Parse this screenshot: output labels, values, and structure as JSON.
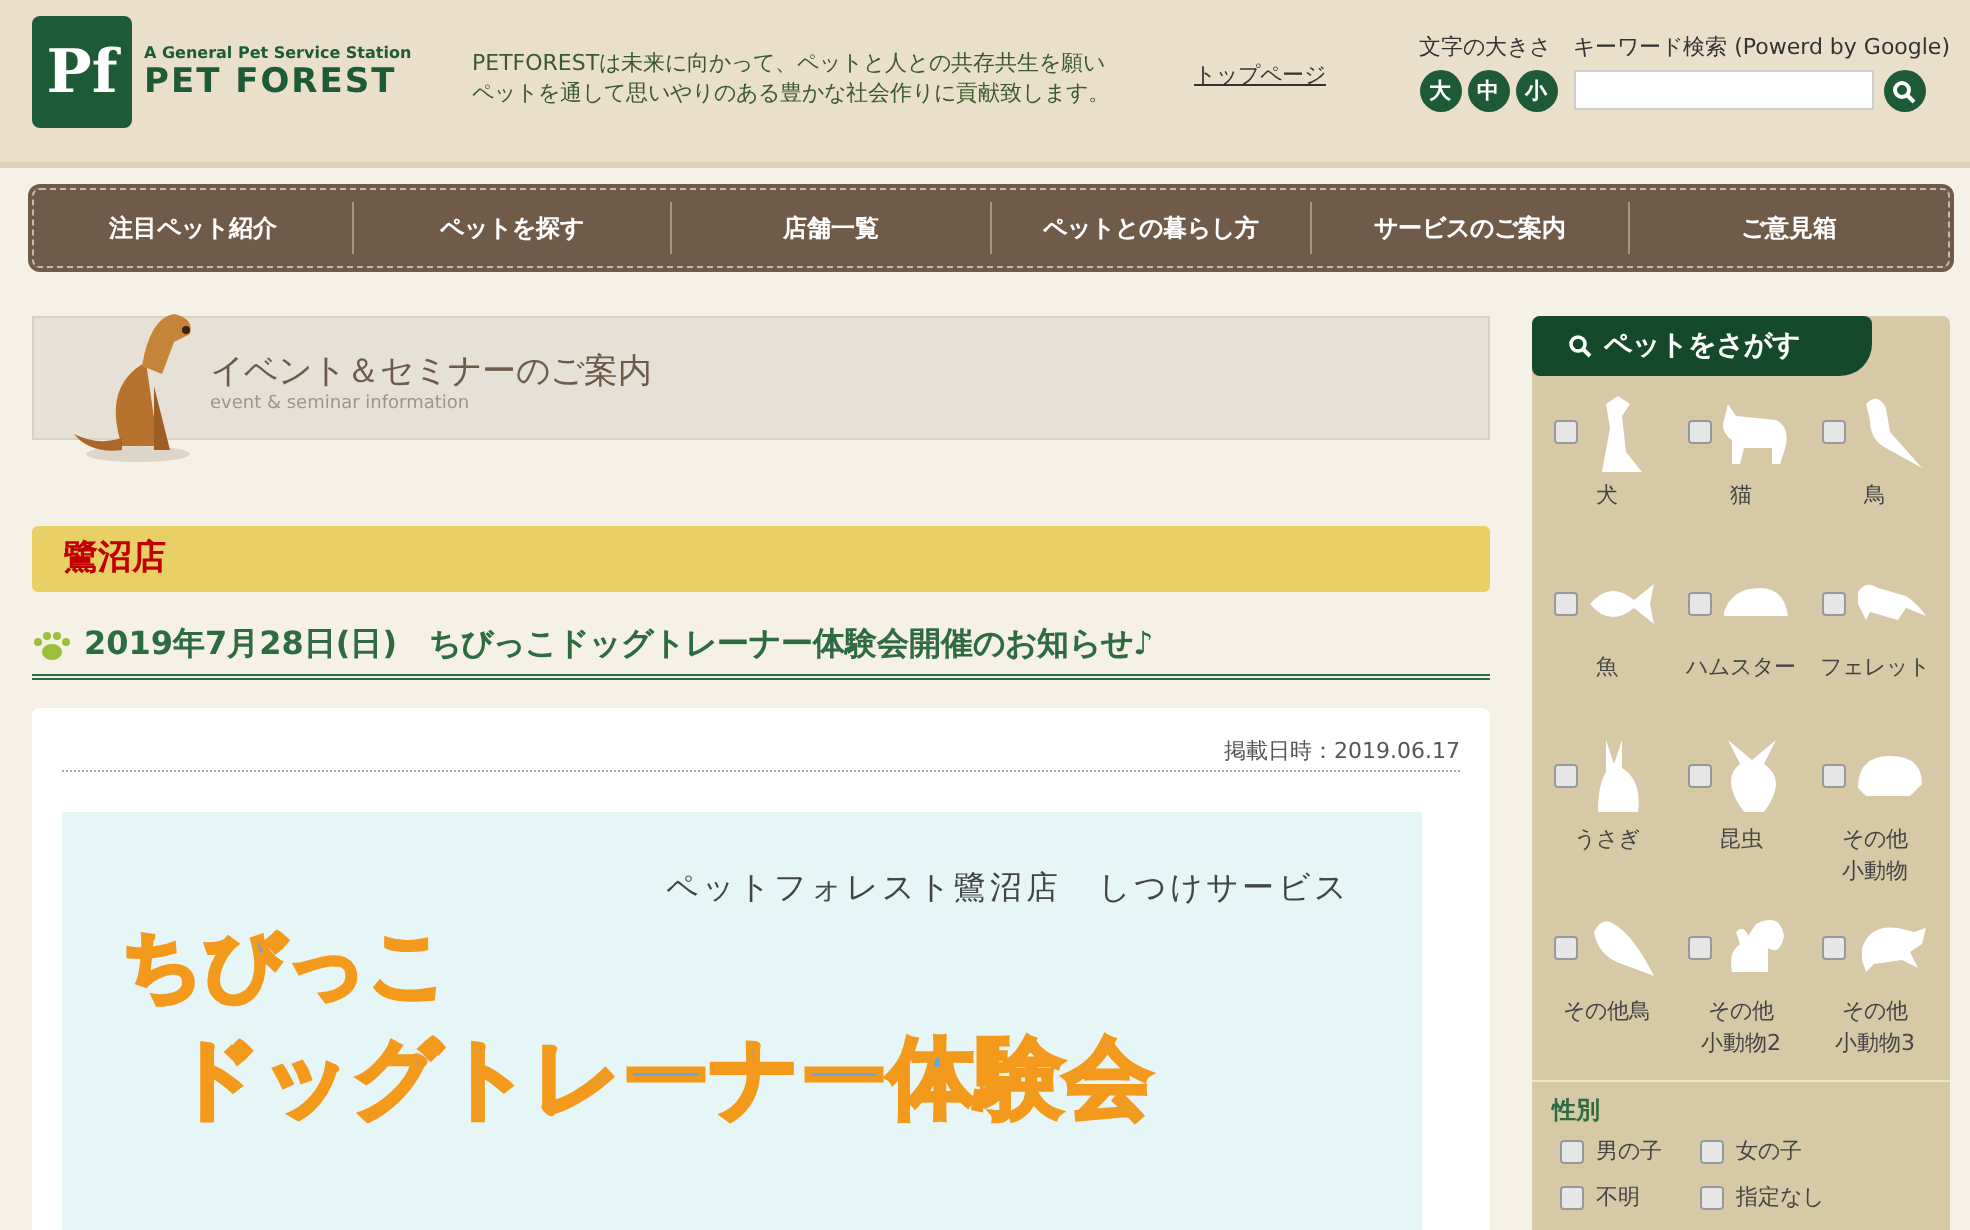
{
  "header": {
    "logo": {
      "mark": "Pf",
      "tagline": "A General Pet Service Station",
      "name": "PET FOREST"
    },
    "description": [
      "PETFORESTは未来に向かって、ペットと人との共存共生を願い",
      "ペットを通して思いやりのある豊かな社会作りに貢献致します。"
    ],
    "top_link": "トップページ",
    "font_size": {
      "label": "文字の大きさ",
      "buttons": [
        "大",
        "中",
        "小"
      ]
    },
    "search": {
      "label": "キーワード検索 (Powerd by Google)"
    }
  },
  "nav": [
    "注目ペット紹介",
    "ペットを探す",
    "店舗一覧",
    "ペットとの暮らし方",
    "サービスのご案内",
    "ご意見箱"
  ],
  "banner": {
    "title": "イベント＆セミナーのご案内",
    "subtitle": "event & seminar information"
  },
  "store": "鷺沼店",
  "article": {
    "title": "2019年7月28日(日)　ちびっこドッグトレーナー体験会開催のお知らせ♪",
    "posted": "掲載日時：2019.06.17",
    "flyer": {
      "subtitle": "ペットフォレスト鷺沼店　しつけサービス",
      "line1": "ちびっこ",
      "line2": "ドッグトレーナー体験会"
    }
  },
  "sidebar": {
    "heading": "ペットをさがす",
    "pets": [
      {
        "label": "犬",
        "checked": false
      },
      {
        "label": "猫",
        "checked": false
      },
      {
        "label": "鳥",
        "checked": false
      },
      {
        "label": "魚",
        "checked": false
      },
      {
        "label": "ハムスター",
        "checked": false
      },
      {
        "label": "フェレット",
        "checked": false
      },
      {
        "label": "うさぎ",
        "checked": false
      },
      {
        "label": "昆虫",
        "checked": false
      },
      {
        "label": [
          "その他",
          "小動物"
        ],
        "checked": false
      },
      {
        "label": "その他鳥",
        "checked": false
      },
      {
        "label": [
          "その他",
          "小動物2"
        ],
        "checked": false
      },
      {
        "label": [
          "その他",
          "小動物3"
        ],
        "checked": false
      }
    ],
    "gender": {
      "heading": "性別",
      "options": [
        {
          "label": "男の子",
          "checked": false
        },
        {
          "label": "女の子",
          "checked": false
        },
        {
          "label": "不明",
          "checked": false
        },
        {
          "label": "指定なし",
          "checked": false
        }
      ]
    }
  }
}
